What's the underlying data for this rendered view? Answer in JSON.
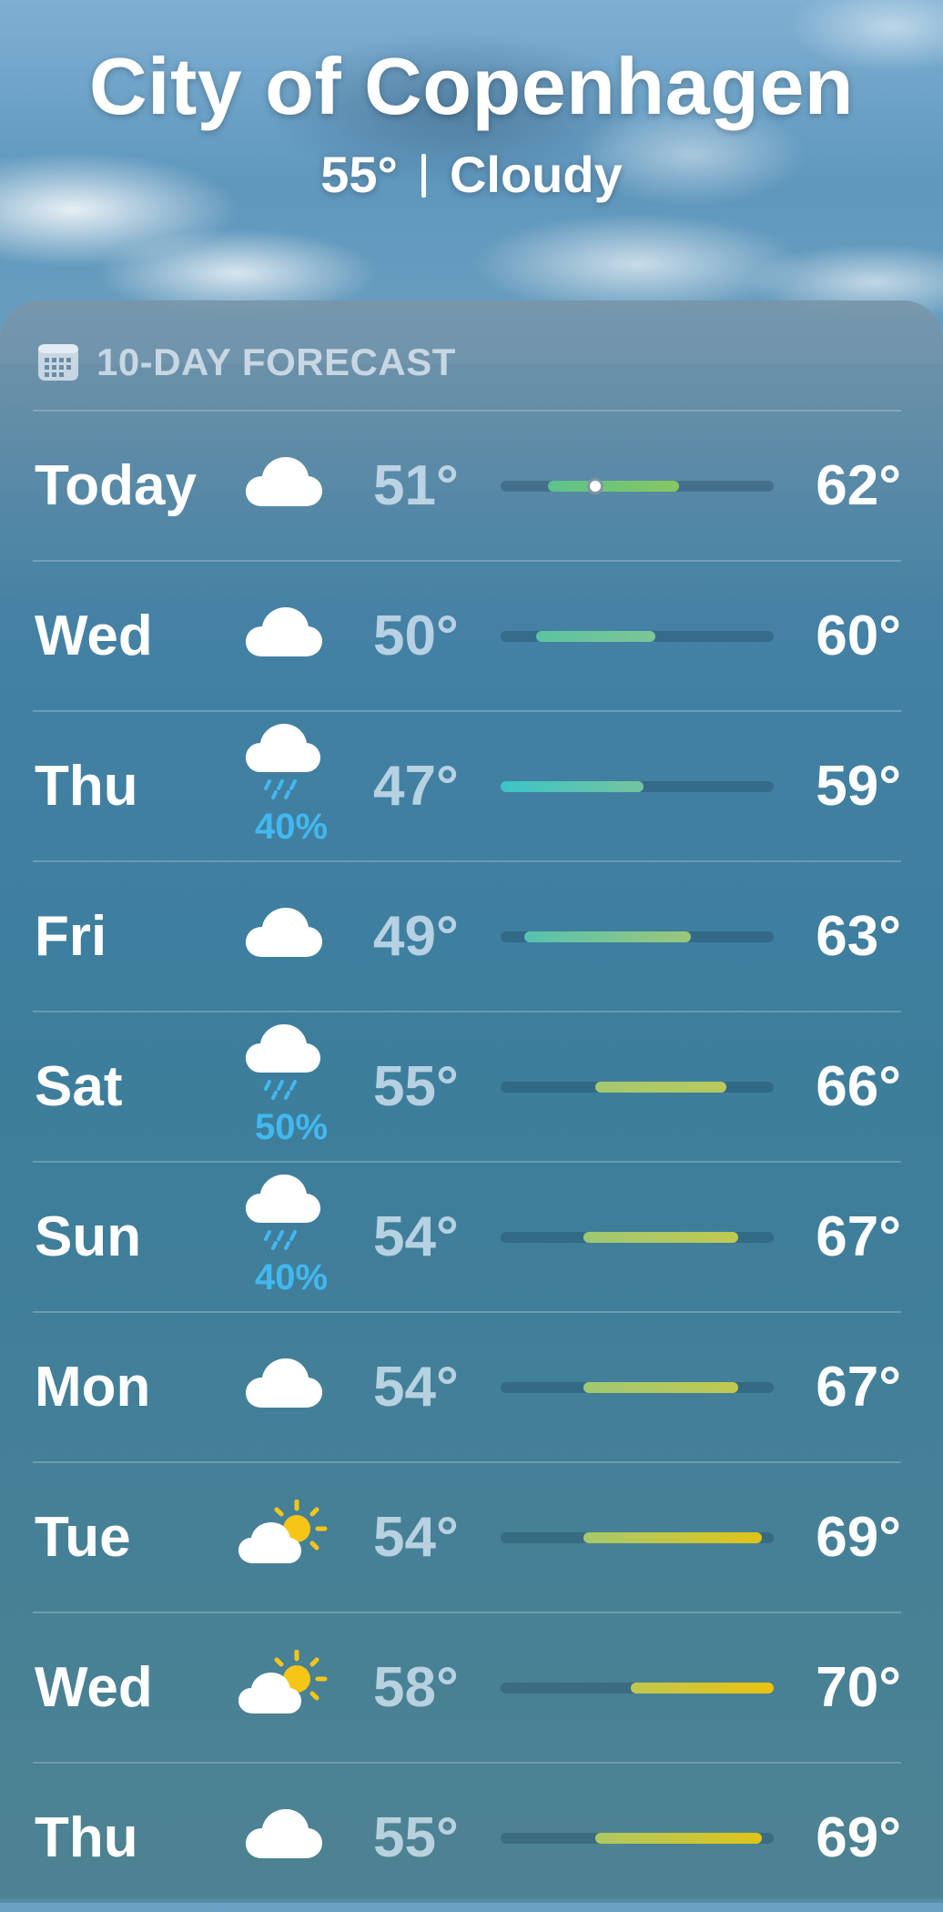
{
  "header": {
    "city": "City of Copenhagen",
    "current_temp": "55°",
    "condition": "Cloudy"
  },
  "forecast": {
    "title": "10-DAY FORECAST",
    "icon": "calendar-icon",
    "range_min": 47,
    "range_max": 70,
    "current_temp_value": 55,
    "days": [
      {
        "day": "Today",
        "icon": "cloud-icon",
        "precip": "",
        "low": "51°",
        "high": "62°",
        "low_value": 51,
        "high_value": 62,
        "colors": [
          "#5cc28c",
          "#86c760"
        ]
      },
      {
        "day": "Wed",
        "icon": "cloud-icon",
        "precip": "",
        "low": "50°",
        "high": "60°",
        "low_value": 50,
        "high_value": 60,
        "colors": [
          "#5cc3a0",
          "#7dc595"
        ]
      },
      {
        "day": "Thu",
        "icon": "cloud-rain-icon",
        "precip": "40%",
        "low": "47°",
        "high": "59°",
        "low_value": 47,
        "high_value": 59,
        "colors": [
          "#3cc4c8",
          "#73c49e"
        ]
      },
      {
        "day": "Fri",
        "icon": "cloud-icon",
        "precip": "",
        "low": "49°",
        "high": "63°",
        "low_value": 49,
        "high_value": 63,
        "colors": [
          "#55c2b0",
          "#9bc77a"
        ]
      },
      {
        "day": "Sat",
        "icon": "cloud-rain-icon",
        "precip": "50%",
        "low": "55°",
        "high": "66°",
        "low_value": 55,
        "high_value": 66,
        "colors": [
          "#a3c86f",
          "#b9c95c"
        ]
      },
      {
        "day": "Sun",
        "icon": "cloud-rain-icon",
        "precip": "40%",
        "low": "54°",
        "high": "67°",
        "low_value": 54,
        "high_value": 67,
        "colors": [
          "#9ec874",
          "#c1c94f"
        ]
      },
      {
        "day": "Mon",
        "icon": "cloud-icon",
        "precip": "",
        "low": "54°",
        "high": "67°",
        "low_value": 54,
        "high_value": 67,
        "colors": [
          "#9ec874",
          "#c1c94f"
        ]
      },
      {
        "day": "Tue",
        "icon": "cloud-sun-icon",
        "precip": "",
        "low": "54°",
        "high": "69°",
        "low_value": 54,
        "high_value": 69,
        "colors": [
          "#a6c86c",
          "#e0c418"
        ]
      },
      {
        "day": "Wed",
        "icon": "cloud-sun-icon",
        "precip": "",
        "low": "58°",
        "high": "70°",
        "low_value": 58,
        "high_value": 70,
        "colors": [
          "#c0c850",
          "#ebc210"
        ]
      },
      {
        "day": "Thu",
        "icon": "cloud-icon",
        "precip": "",
        "low": "55°",
        "high": "69°",
        "low_value": 55,
        "high_value": 69,
        "colors": [
          "#aec863",
          "#e0c418"
        ]
      }
    ]
  },
  "colors": {
    "precip": "#42b8f0",
    "sun": "#f5c518",
    "cloud": "#ffffff"
  }
}
